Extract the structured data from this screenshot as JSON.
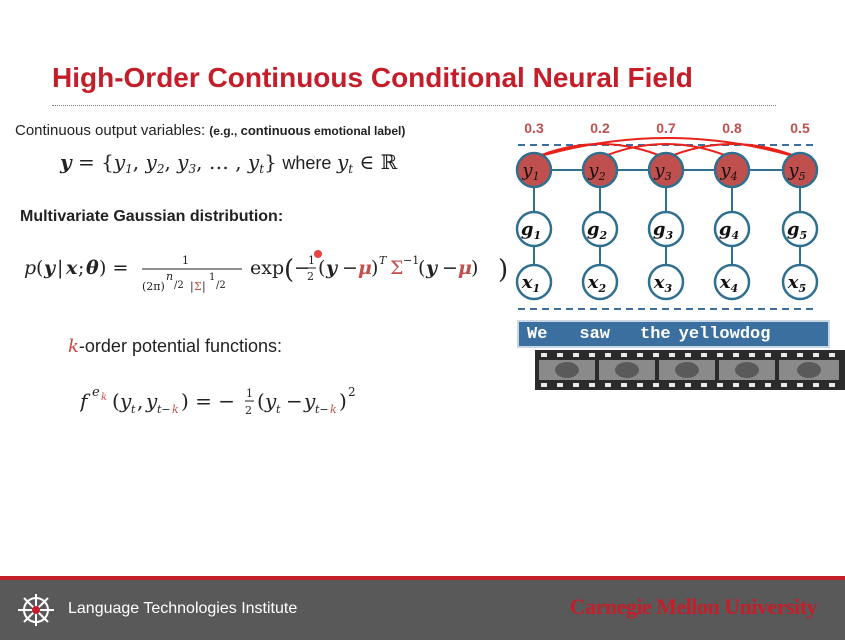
{
  "slide": {
    "title": "High-Order Continuous Conditional Neural Field",
    "continuous_label": "Continuous output variables:",
    "continuous_example_open": "(e.g., ",
    "continuous_example_bold": "continuous",
    "continuous_example_close": " emotional label)",
    "set_word": "where",
    "mvg_heading": "Multivariate Gaussian distribution:",
    "korder_k": "k",
    "korder_text": "-order potential functions:"
  },
  "diagram": {
    "weights": [
      "0.3",
      "0.2",
      "0.7",
      "0.8",
      "0.5"
    ],
    "y_nodes": [
      "y",
      "y",
      "y",
      "y",
      "y"
    ],
    "g_nodes": [
      "g",
      "g",
      "g",
      "g",
      "g"
    ],
    "x_nodes": [
      "x",
      "x",
      "x",
      "x",
      "x"
    ],
    "indices": [
      "1",
      "2",
      "3",
      "4",
      "5"
    ],
    "banner_words": [
      "We",
      "saw",
      "the",
      "yellowdog"
    ],
    "colors": {
      "y_node": "#c0504d",
      "edge": "#2f6f8f",
      "arc": "#e8221b",
      "dashed": "#3a6fa0"
    }
  },
  "footer": {
    "institute": "Language Technologies Institute",
    "university": "Carnegie Mellon University"
  }
}
